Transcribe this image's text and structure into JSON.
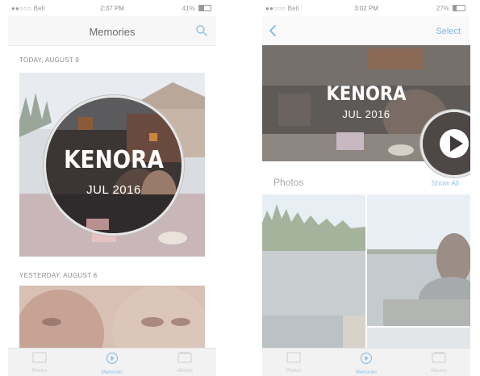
{
  "left_screen": {
    "status": {
      "carrier": "●●○○○ Bell",
      "time": "2:37 PM",
      "battery": "41%",
      "battery_level": 0.41
    },
    "nav": {
      "title": "Memories"
    },
    "sections": [
      {
        "label": "TODAY, AUGUST 9",
        "memory_title": "KENORA",
        "memory_date": "JUL 2016"
      },
      {
        "label": "YESTERDAY, AUGUST 8"
      }
    ],
    "tabs": [
      {
        "label": "Photos",
        "icon": "photos-icon"
      },
      {
        "label": "Memories",
        "icon": "memories-icon",
        "active": true
      },
      {
        "label": "Albums",
        "icon": "albums-icon"
      }
    ]
  },
  "right_screen": {
    "status": {
      "carrier": "●●○○○ Bell",
      "time": "3:02 PM",
      "battery": "27%",
      "battery_level": 0.27
    },
    "nav": {
      "back_icon": "chevron-left-icon",
      "select_label": "Select"
    },
    "header": {
      "title": "KENORA",
      "date": "JUL 2016"
    },
    "play_icon": "play-icon",
    "photos_section": {
      "title": "Photos",
      "show_all": "Show All"
    },
    "tabs": [
      {
        "label": "Photos",
        "icon": "photos-icon"
      },
      {
        "label": "Memories",
        "icon": "memories-icon",
        "active": true
      },
      {
        "label": "Albums",
        "icon": "albums-icon"
      }
    ]
  },
  "colors": {
    "accent": "#8fbfe8",
    "faded_text": "#8a8a8a"
  }
}
